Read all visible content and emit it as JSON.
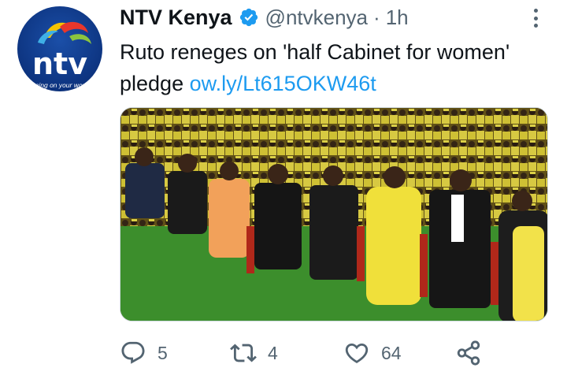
{
  "tweet": {
    "display_name": "NTV Kenya",
    "verified": true,
    "handle": "@ntvkenya",
    "separator": "·",
    "timestamp": "1h",
    "text": "Ruto reneges on 'half Cabinet for women' pledge",
    "link": "ow.ly/Lt615OKW46t"
  },
  "avatar": {
    "logo_text": "ntv",
    "tagline": "turning on your world"
  },
  "actions": {
    "reply_count": "5",
    "retweet_count": "4",
    "like_count": "64"
  },
  "icons": {
    "more": "more-vertical-icon",
    "verified": "verified-badge-icon",
    "reply": "reply-icon",
    "retweet": "retweet-icon",
    "like": "heart-icon",
    "share": "share-icon"
  },
  "colors": {
    "link": "#1d9bf0",
    "verified": "#1d9bf0",
    "secondary_text": "#536471",
    "primary_text": "#0f1419"
  }
}
